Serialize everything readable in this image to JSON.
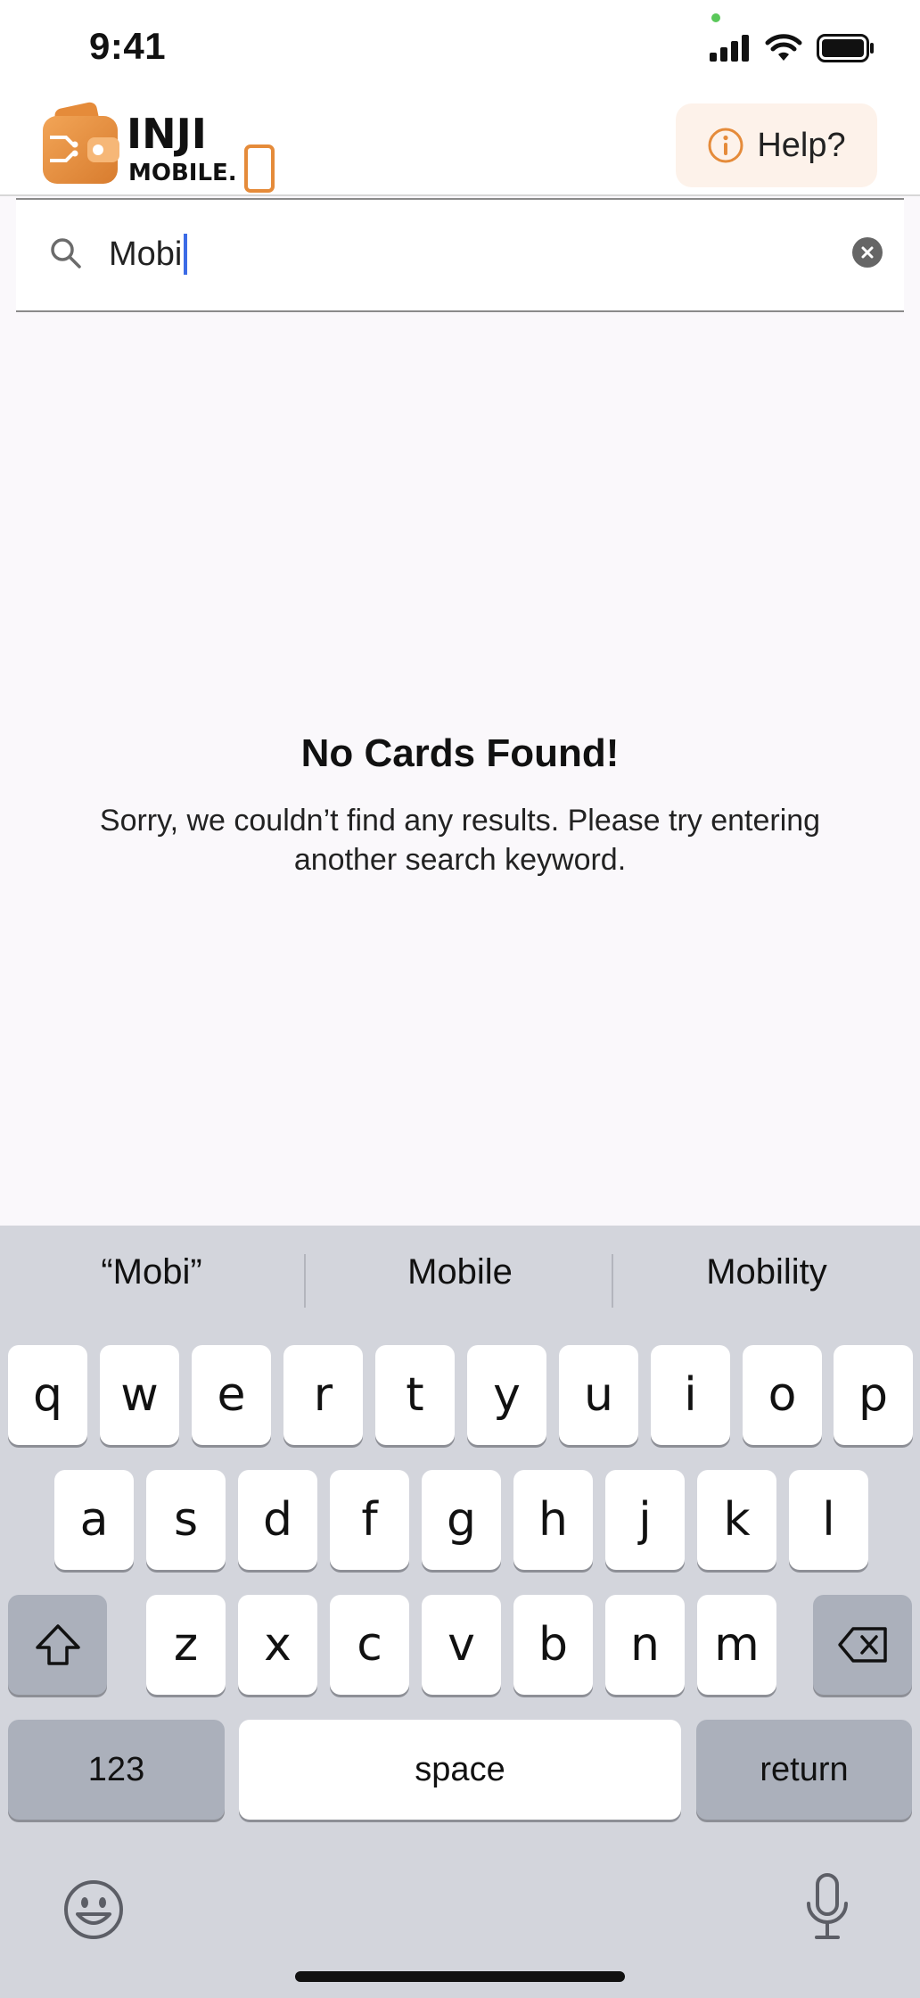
{
  "status_bar": {
    "time": "9:41"
  },
  "header": {
    "logo_text_line1": "INJI",
    "logo_text_line2": "MOBILE.",
    "help_label": "Help?"
  },
  "search": {
    "value": "Mobi"
  },
  "empty_state": {
    "title": "No Cards Found!",
    "message": "Sorry, we couldn’t find any results. Please try entering another search keyword."
  },
  "keyboard": {
    "suggestions": [
      "“Mobi”",
      "Mobile",
      "Mobility"
    ],
    "row1": [
      "q",
      "w",
      "e",
      "r",
      "t",
      "y",
      "u",
      "i",
      "o",
      "p"
    ],
    "row2": [
      "a",
      "s",
      "d",
      "f",
      "g",
      "h",
      "j",
      "k",
      "l"
    ],
    "row3": [
      "z",
      "x",
      "c",
      "v",
      "b",
      "n",
      "m"
    ],
    "numbers_label": "123",
    "space_label": "space",
    "return_label": "return"
  },
  "colors": {
    "brand_orange": "#E8923F",
    "help_bg": "#FDF2EA",
    "caret": "#3B6BE6"
  }
}
